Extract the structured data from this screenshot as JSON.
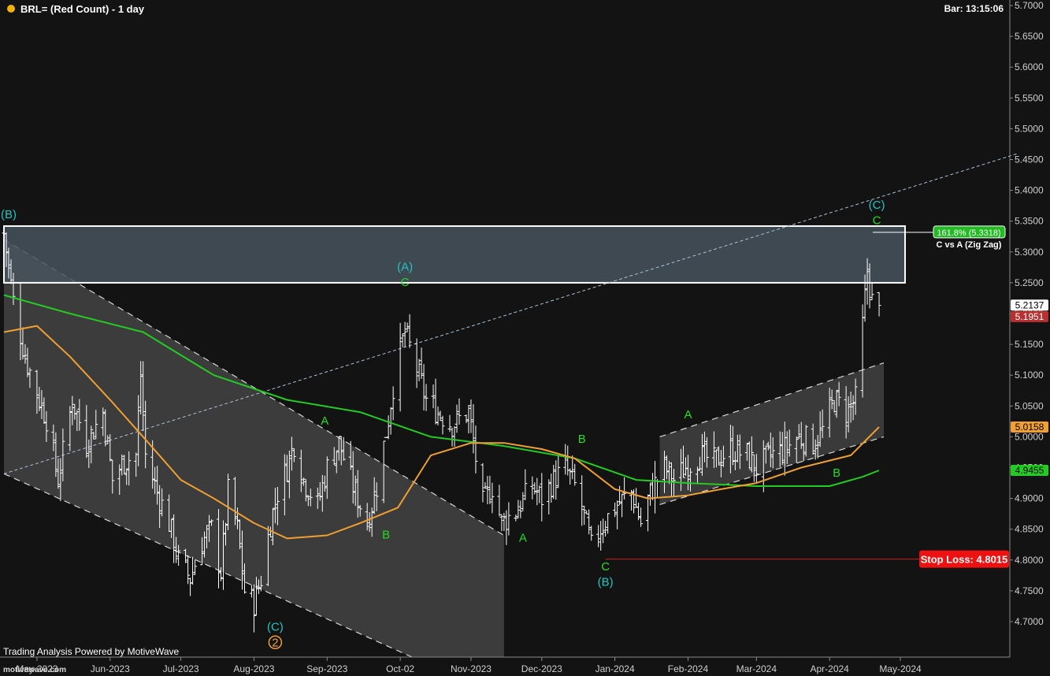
{
  "header": {
    "title": "BRL= (Red Count) - 1 day",
    "bar_time": "Bar: 13:15:06",
    "dot_color": "#f0b400"
  },
  "footer": {
    "credit": "Trading Analysis Powered by MotiveWave",
    "watermark": "motivewave.com"
  },
  "chart_data": {
    "type": "ohlc",
    "instrument": "BRL=",
    "count": "Red Count",
    "interval": "1 day",
    "ylim": [
      4.64,
      5.71
    ],
    "y_ticks": [
      5.7,
      5.65,
      5.6,
      5.55,
      5.5,
      5.45,
      5.4,
      5.35,
      5.3,
      5.25,
      5.2,
      5.15,
      5.1,
      5.05,
      5.0,
      4.95,
      4.9,
      4.85,
      4.8,
      4.75,
      4.7
    ],
    "y_tick_labels": [
      "5.7000",
      "5.6500",
      "5.6000",
      "5.5500",
      "5.5000",
      "5.4500",
      "5.4000",
      "5.3500",
      "5.3000",
      "5.2500",
      "5.2000",
      "5.1500",
      "5.1000",
      "5.0500",
      "5.0000",
      "4.9500",
      "4.9000",
      "4.8500",
      "4.8000",
      "4.7500",
      "4.7000"
    ],
    "x_labels": [
      {
        "label": "May-2023",
        "date": "2023-05-01"
      },
      {
        "label": "Jun-2023",
        "date": "2023-06-01"
      },
      {
        "label": "Jul-2023",
        "date": "2023-07-01"
      },
      {
        "label": "Aug-2023",
        "date": "2023-08-01"
      },
      {
        "label": "Sep-2023",
        "date": "2023-09-01"
      },
      {
        "label": "Oct-02",
        "date": "2023-10-02"
      },
      {
        "label": "Nov-2023",
        "date": "2023-11-01"
      },
      {
        "label": "Dec-2023",
        "date": "2023-12-01"
      },
      {
        "label": "Jan-2024",
        "date": "2024-01-01"
      },
      {
        "label": "Feb-2024",
        "date": "2024-02-01"
      },
      {
        "label": "Mar-2024",
        "date": "2024-03-01"
      },
      {
        "label": "Apr-2024",
        "date": "2024-04-01"
      },
      {
        "label": "May-2024",
        "date": "2024-05-01"
      }
    ],
    "price_path": [
      [
        "2023-04-17",
        5.33
      ],
      [
        "2023-04-21",
        5.22
      ],
      [
        "2023-04-26",
        5.13
      ],
      [
        "2023-05-01",
        5.07
      ],
      [
        "2023-05-05",
        5.03
      ],
      [
        "2023-05-10",
        4.93
      ],
      [
        "2023-05-16",
        5.06
      ],
      [
        "2023-05-22",
        4.99
      ],
      [
        "2023-05-29",
        5.04
      ],
      [
        "2023-06-02",
        4.93
      ],
      [
        "2023-06-07",
        4.96
      ],
      [
        "2023-06-12",
        4.97
      ],
      [
        "2023-06-14",
        5.1
      ],
      [
        "2023-06-16",
        4.97
      ],
      [
        "2023-06-21",
        4.91
      ],
      [
        "2023-06-26",
        4.86
      ],
      [
        "2023-06-30",
        4.8
      ],
      [
        "2023-07-05",
        4.77
      ],
      [
        "2023-07-10",
        4.83
      ],
      [
        "2023-07-14",
        4.85
      ],
      [
        "2023-07-18",
        4.78
      ],
      [
        "2023-07-21",
        4.91
      ],
      [
        "2023-07-25",
        4.85
      ],
      [
        "2023-07-28",
        4.75
      ],
      [
        "2023-08-01",
        4.73
      ],
      [
        "2023-08-04",
        4.77
      ],
      [
        "2023-08-08",
        4.86
      ],
      [
        "2023-08-11",
        4.91
      ],
      [
        "2023-08-15",
        4.95
      ],
      [
        "2023-08-18",
        4.99
      ],
      [
        "2023-08-22",
        4.93
      ],
      [
        "2023-08-28",
        4.89
      ],
      [
        "2023-09-01",
        4.95
      ],
      [
        "2023-09-06",
        4.99
      ],
      [
        "2023-09-12",
        4.92
      ],
      [
        "2023-09-18",
        4.86
      ],
      [
        "2023-09-22",
        4.92
      ],
      [
        "2023-09-27",
        5.03
      ],
      [
        "2023-09-30",
        5.11
      ],
      [
        "2023-10-04",
        5.17
      ],
      [
        "2023-10-09",
        5.11
      ],
      [
        "2023-10-13",
        5.06
      ],
      [
        "2023-10-18",
        5.04
      ],
      [
        "2023-10-24",
        5.02
      ],
      [
        "2023-10-31",
        5.04
      ],
      [
        "2023-11-06",
        4.89
      ],
      [
        "2023-11-10",
        4.92
      ],
      [
        "2023-11-14",
        4.86
      ],
      [
        "2023-11-20",
        4.88
      ],
      [
        "2023-11-27",
        4.92
      ],
      [
        "2023-12-01",
        4.9
      ],
      [
        "2023-12-06",
        4.93
      ],
      [
        "2023-12-11",
        4.95
      ],
      [
        "2023-12-15",
        4.92
      ],
      [
        "2023-12-19",
        4.87
      ],
      [
        "2023-12-22",
        4.82
      ],
      [
        "2023-12-27",
        4.86
      ],
      [
        "2024-01-02",
        4.89
      ],
      [
        "2024-01-08",
        4.91
      ],
      [
        "2024-01-12",
        4.86
      ],
      [
        "2024-01-16",
        4.91
      ],
      [
        "2024-01-22",
        4.95
      ],
      [
        "2024-01-26",
        4.93
      ],
      [
        "2024-01-31",
        4.95
      ],
      [
        "2024-02-06",
        4.97
      ],
      [
        "2024-02-12",
        4.96
      ],
      [
        "2024-02-19",
        4.98
      ],
      [
        "2024-02-26",
        4.97
      ],
      [
        "2024-03-01",
        4.95
      ],
      [
        "2024-03-07",
        4.97
      ],
      [
        "2024-03-13",
        4.98
      ],
      [
        "2024-03-19",
        5.0
      ],
      [
        "2024-03-25",
        4.99
      ],
      [
        "2024-03-29",
        5.01
      ],
      [
        "2024-04-03",
        5.06
      ],
      [
        "2024-04-08",
        5.04
      ],
      [
        "2024-04-12",
        5.06
      ],
      [
        "2024-04-15",
        5.18
      ],
      [
        "2024-04-17",
        5.27
      ],
      [
        "2024-04-19",
        5.22
      ],
      [
        "2024-04-22",
        5.2
      ]
    ],
    "ma_slow": {
      "color": "#22cc22",
      "label": "4.9455",
      "points": [
        [
          "2023-04-17",
          5.23
        ],
        [
          "2023-05-15",
          5.2
        ],
        [
          "2023-06-15",
          5.17
        ],
        [
          "2023-07-15",
          5.1
        ],
        [
          "2023-08-15",
          5.06
        ],
        [
          "2023-09-15",
          5.04
        ],
        [
          "2023-10-15",
          5.0
        ],
        [
          "2023-11-15",
          4.985
        ],
        [
          "2023-12-15",
          4.965
        ],
        [
          "2024-01-10",
          4.93
        ],
        [
          "2024-02-01",
          4.925
        ],
        [
          "2024-03-01",
          4.92
        ],
        [
          "2024-04-01",
          4.92
        ],
        [
          "2024-04-15",
          4.935
        ],
        [
          "2024-04-22",
          4.9455
        ]
      ]
    },
    "ma_fast": {
      "color": "#f0a030",
      "label": "5.0158",
      "points": [
        [
          "2023-04-17",
          5.17
        ],
        [
          "2023-05-01",
          5.18
        ],
        [
          "2023-05-15",
          5.13
        ],
        [
          "2023-06-01",
          5.06
        ],
        [
          "2023-06-15",
          5.0
        ],
        [
          "2023-07-01",
          4.93
        ],
        [
          "2023-07-15",
          4.9
        ],
        [
          "2023-08-01",
          4.86
        ],
        [
          "2023-08-15",
          4.835
        ],
        [
          "2023-09-01",
          4.84
        ],
        [
          "2023-09-15",
          4.86
        ],
        [
          "2023-10-01",
          4.885
        ],
        [
          "2023-10-15",
          4.97
        ],
        [
          "2023-11-01",
          4.99
        ],
        [
          "2023-11-15",
          4.99
        ],
        [
          "2023-12-01",
          4.98
        ],
        [
          "2023-12-15",
          4.965
        ],
        [
          "2024-01-01",
          4.915
        ],
        [
          "2024-01-15",
          4.9
        ],
        [
          "2024-02-01",
          4.905
        ],
        [
          "2024-02-15",
          4.915
        ],
        [
          "2024-03-01",
          4.925
        ],
        [
          "2024-03-20",
          4.95
        ],
        [
          "2024-04-10",
          4.97
        ],
        [
          "2024-04-22",
          5.0158
        ]
      ]
    },
    "price_labels": [
      {
        "value": 5.2137,
        "label": "5.2137",
        "bg": "#ffffff",
        "fg": "#000000"
      },
      {
        "value": 5.1951,
        "label": "5.1951",
        "bg": "#b83030",
        "fg": "#ffffff"
      },
      {
        "value": 5.0158,
        "label": "5.0158",
        "bg": "#f0a030",
        "fg": "#000000"
      },
      {
        "value": 4.9455,
        "label": "4.9455",
        "bg": "#22cc22",
        "fg": "#000000"
      }
    ],
    "target_zone": {
      "x0": "2023-04-17",
      "x1": "2024-05-03",
      "y0": 5.25,
      "y1": 5.342
    },
    "fib_label": {
      "text": "161.8% (5.3318)",
      "sublabel": "C vs A (Zig Zag)",
      "value": 5.3318
    },
    "stop_loss": {
      "label": "Stop Loss: 4.8015",
      "value": 4.8015,
      "from": "2023-12-28"
    },
    "trend_line": {
      "from": [
        "2023-04-17",
        4.94
      ],
      "to": [
        "2024-06-20",
        5.46
      ]
    },
    "down_channel": {
      "upper": [
        [
          "2023-04-17",
          5.32
        ],
        [
          "2023-11-15",
          4.84
        ]
      ],
      "lower": [
        [
          "2023-04-17",
          4.94
        ],
        [
          "2023-10-07",
          4.42
        ]
      ],
      "end_date": "2023-11-15"
    },
    "up_channel": {
      "upper": [
        [
          "2024-01-20",
          5.0
        ],
        [
          "2024-04-24",
          5.12
        ]
      ],
      "lower": [
        [
          "2024-01-20",
          4.89
        ],
        [
          "2024-04-24",
          5.0
        ]
      ]
    },
    "wave_labels": [
      {
        "text": "(B)",
        "date": "2023-04-19",
        "value": 5.355,
        "color": "#22c4c4"
      },
      {
        "text": "(A)",
        "date": "2023-10-04",
        "value": 5.27,
        "color": "#22c4c4"
      },
      {
        "text": "C",
        "date": "2023-10-04",
        "value": 5.245,
        "color": "#22dd22"
      },
      {
        "text": "A",
        "date": "2023-08-31",
        "value": 5.02,
        "color": "#22dd22"
      },
      {
        "text": "B",
        "date": "2023-09-26",
        "value": 4.835,
        "color": "#22dd22"
      },
      {
        "text": "(C)",
        "date": "2023-08-10",
        "value": 4.685,
        "color": "#22c4c4"
      },
      {
        "text": "2",
        "date": "2023-08-10",
        "value": 4.66,
        "color": "#f0a030",
        "circled": true
      },
      {
        "text": "A",
        "date": "2023-11-23",
        "value": 4.83,
        "color": "#22dd22"
      },
      {
        "text": "B",
        "date": "2023-12-18",
        "value": 4.99,
        "color": "#22dd22"
      },
      {
        "text": "C",
        "date": "2023-12-28",
        "value": 4.783,
        "color": "#22dd22"
      },
      {
        "text": "(B)",
        "date": "2023-12-28",
        "value": 4.758,
        "color": "#22c4c4"
      },
      {
        "text": "A",
        "date": "2024-02-01",
        "value": 5.03,
        "color": "#22dd22"
      },
      {
        "text": "B",
        "date": "2024-04-04",
        "value": 4.935,
        "color": "#22dd22"
      },
      {
        "text": "(C)",
        "date": "2024-04-21",
        "value": 5.37,
        "color": "#22c4c4"
      },
      {
        "text": "C",
        "date": "2024-04-21",
        "value": 5.345,
        "color": "#22dd22"
      }
    ]
  }
}
